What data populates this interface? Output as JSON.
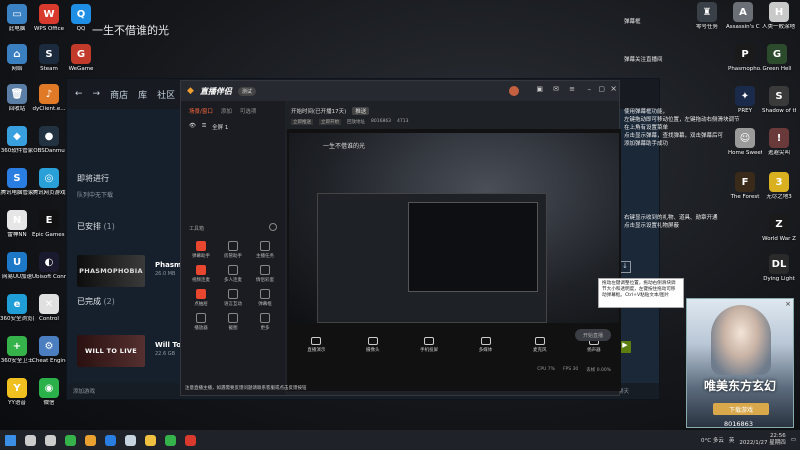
{
  "desktop": {
    "left_icons": [
      {
        "label": "此电脑",
        "color": "#3b82c4",
        "glyph": "▭"
      },
      {
        "label": "WPS Office",
        "color": "#d83a2e",
        "glyph": "W"
      },
      {
        "label": "QQ",
        "color": "#1f8fe6",
        "glyph": "Q"
      },
      {
        "label": "网络",
        "color": "#3a7fc0",
        "glyph": "⌂"
      },
      {
        "label": "Steam",
        "color": "#1b2a3c",
        "glyph": "S"
      },
      {
        "label": "WeGame",
        "color": "#c23b2a",
        "glyph": "G"
      },
      {
        "label": "回收站",
        "color": "#5a7ea6",
        "glyph": "🗑"
      },
      {
        "label": "dyClient.e...",
        "color": "#e07a26",
        "glyph": "♪"
      },
      {
        "label": "360软件管家",
        "color": "#39a0e0",
        "glyph": "◆"
      },
      {
        "label": "OBSDanmu",
        "color": "#233240",
        "glyph": "●"
      },
      {
        "label": "腾讯电脑管家",
        "color": "#2a7de1",
        "glyph": "S"
      },
      {
        "label": "腾讯网页游戏",
        "color": "#29a0d8",
        "glyph": "◎"
      },
      {
        "label": "雷神NN",
        "color": "#e6e6e6",
        "glyph": "N"
      },
      {
        "label": "Epic Games Launcher",
        "color": "#111111",
        "glyph": "E"
      },
      {
        "label": "网易UU加速",
        "color": "#1d78c8",
        "glyph": "U"
      },
      {
        "label": "Ubisoft Connect",
        "color": "#1a1a2e",
        "glyph": "◐"
      },
      {
        "label": "360安全浏览器",
        "color": "#1f9ed8",
        "glyph": "e"
      },
      {
        "label": "Control",
        "color": "#e0e0e0",
        "glyph": "✕"
      },
      {
        "label": "360安全卫士",
        "color": "#35b24a",
        "glyph": "+"
      },
      {
        "label": "Cheat Engine",
        "color": "#4a7ec0",
        "glyph": "⚙"
      },
      {
        "label": "YY语音",
        "color": "#f0c020",
        "glyph": "Y"
      },
      {
        "label": "微信",
        "color": "#2ab14a",
        "glyph": "◉"
      }
    ],
    "right_icons": [
      {
        "label": "零号任务",
        "color": "#3a4048",
        "glyph": "♜"
      },
      {
        "label": "Assassin's Creed Valh...",
        "color": "#6b6f76",
        "glyph": "A"
      },
      {
        "label": "人类一败涂地 Human Fa...",
        "color": "#c9c9c9",
        "glyph": "H"
      },
      {
        "label": "Phasmopho...",
        "color": "#1a1a1a",
        "glyph": "P"
      },
      {
        "label": "Green Hell",
        "color": "#2c4a2c",
        "glyph": "G"
      },
      {
        "label": "PREY",
        "color": "#1a2a4a",
        "glyph": "✦"
      },
      {
        "label": "Shadow of the Tom...",
        "color": "#3a3a3a",
        "glyph": "S"
      },
      {
        "label": "Home Sweet Home",
        "color": "#9a9a9a",
        "glyph": "☺"
      },
      {
        "label": "逃避尖叫",
        "color": "#6a3a3a",
        "glyph": "!"
      },
      {
        "label": "The Forest",
        "color": "#3a2a1a",
        "glyph": "F"
      },
      {
        "label": "无尽之地3",
        "color": "#d8b020",
        "glyph": "3"
      },
      {
        "label": "World War Z",
        "color": "#1a1a1a",
        "glyph": "Z"
      },
      {
        "label": "Dying Light",
        "color": "#2a2a2a",
        "glyph": "DL"
      }
    ],
    "title_text": "一生不借谁的光"
  },
  "steam": {
    "nav": [
      "商店",
      "库",
      "社区",
      "镜"
    ],
    "in_progress_header": "即将进行",
    "in_progress_empty": "队列中无下载",
    "installed_header": "已安排",
    "installed_count": "(1)",
    "installed_game": {
      "card": "PHASMOPHOBIA",
      "name": "Phasm",
      "size": "26.0 MB"
    },
    "completed_header": "已完成",
    "completed_count": "(2)",
    "completed_game": {
      "card": "WILL TO LIVE",
      "name": "Will To",
      "size": "22.6 GB"
    },
    "add_game": "添加游戏",
    "downloads_label": "下载",
    "downloads_sub": "已完成 1 个项目中的 1 个",
    "friends_label": "好友与聊天"
  },
  "tool": {
    "app_name": "直播伴侣",
    "badge": "测试",
    "tabs": [
      "场景/窗口",
      "添加",
      "可选项"
    ],
    "scene_label": "全屏 1",
    "top_info": "开始时间(已开播17天)",
    "top_badge": "推送",
    "mini_chip_1": "立即推送",
    "mini_chip_2": "立即开始",
    "room_label": "回放地址",
    "room_id": "8016863",
    "viewer": "4713",
    "tools_header": "工具箱",
    "tools": [
      {
        "label": "弹幕助手",
        "red": true
      },
      {
        "label": "房管助手",
        "red": false
      },
      {
        "label": "主播任务",
        "red": false
      },
      {
        "label": "视频连麦",
        "red": true
      },
      {
        "label": "多人连麦",
        "red": false
      },
      {
        "label": "情侣彩蛋",
        "red": false
      },
      {
        "label": "点抽屉",
        "red": true
      },
      {
        "label": "语言互动",
        "red": false
      },
      {
        "label": "弹幕框",
        "red": false
      },
      {
        "label": "播放器",
        "red": false
      },
      {
        "label": "截图",
        "red": false
      },
      {
        "label": "更多",
        "red": false
      }
    ],
    "controls": [
      "直播演示",
      "摄像头",
      "手机投屏",
      "多媒体",
      "麦克风",
      "扬声器"
    ],
    "start_button": "开始直播",
    "status_cpu": "CPU 7%",
    "status_fps": "FPS 30",
    "status_net": "丢帧 0.00%",
    "notice": "注意直播主播，如遇需要反馈问题请联系客服或点击反馈按钮"
  },
  "info": {
    "lines_top": [
      "弹幕框",
      "弹幕关注直播间"
    ],
    "line_block_1": [
      "使用弹幕框功能，",
      "左键拖动即可移动位置，左键拖动右侧滑块调节",
      "在上角有设置菜单",
      "点击显示弹幕，查找弹幕，双击弹幕后可",
      "添加弹幕助手成功"
    ],
    "line_block_2": [
      "右键显示收到的礼物、道具、勋章开通",
      "点击显示设置礼物屏蔽"
    ]
  },
  "popup": {
    "text": "拖动左键调整位置，拖动右侧滑块调节大小和透明度，左键按住拖动可移动弹幕框。Ctrl+V粘贴文本/图片"
  },
  "ad": {
    "title": "唯美东方玄幻",
    "button": "下载游戏",
    "close": "×"
  },
  "taskbar": {
    "apps": [
      {
        "name": "start",
        "color": "#3a8ee6"
      },
      {
        "name": "search",
        "color": "#cccccc"
      },
      {
        "name": "taskview",
        "color": "#cccccc"
      },
      {
        "name": "360browser",
        "color": "#35b24a"
      },
      {
        "name": "streamer-tool",
        "color": "#e8a030"
      },
      {
        "name": "edge",
        "color": "#2a7de1"
      },
      {
        "name": "steam",
        "color": "#c6d4df"
      },
      {
        "name": "explorer",
        "color": "#f0c040"
      },
      {
        "name": "360safe",
        "color": "#35b24a"
      },
      {
        "name": "netease",
        "color": "#d83a2e"
      }
    ],
    "weather": "0°C 多云",
    "lang": "英",
    "time": "22:56",
    "date": "2022/1/27 星期四"
  },
  "room_number": "8016863"
}
